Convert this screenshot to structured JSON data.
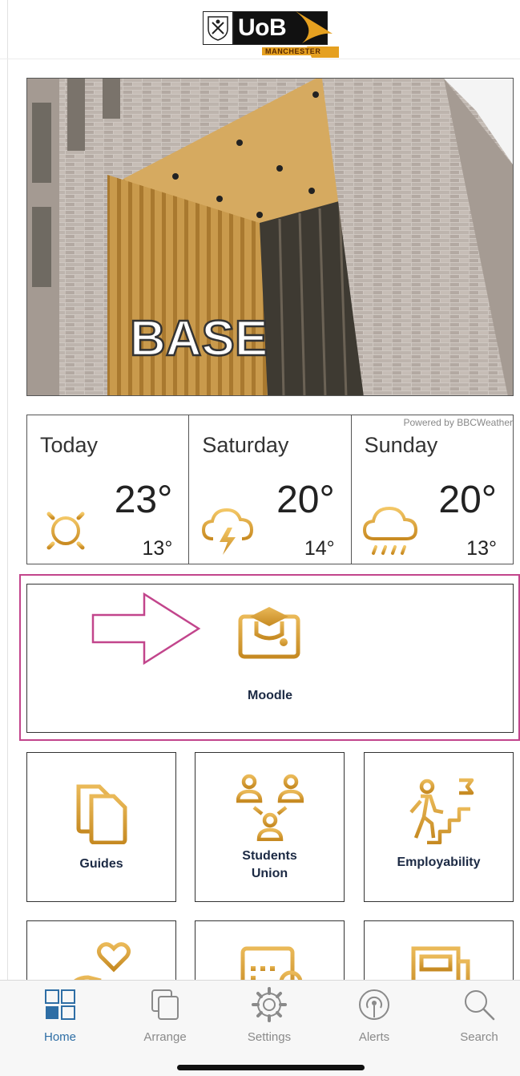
{
  "header": {
    "logo_text": "UoB",
    "logo_subtext": "MANCHESTER"
  },
  "hero": {
    "sign_text": "BASE"
  },
  "weather": {
    "powered_by": "Powered by BBCWeather",
    "days": [
      {
        "day": "Today",
        "high": "23°",
        "low": "13°",
        "icon": "sun-icon"
      },
      {
        "day": "Saturday",
        "high": "20°",
        "low": "14°",
        "icon": "thunderstorm-icon"
      },
      {
        "day": "Sunday",
        "high": "20°",
        "low": "13°",
        "icon": "rain-cloud-icon"
      }
    ]
  },
  "moodle": {
    "label": "Moodle",
    "icon": "graduation-monitor-icon",
    "highlight_color": "#c2458c"
  },
  "tiles": [
    {
      "label": "Guides",
      "icon": "documents-icon"
    },
    {
      "label": "Students\nUnion",
      "icon": "people-network-icon"
    },
    {
      "label": "Employability",
      "icon": "career-stairs-icon"
    },
    {
      "label": "",
      "icon": "heart-hand-icon"
    },
    {
      "label": "",
      "icon": "calendar-icon"
    },
    {
      "label": "",
      "icon": "newspaper-icon"
    }
  ],
  "tabbar": {
    "tabs": [
      {
        "label": "Home",
        "icon": "grid-icon",
        "active": true
      },
      {
        "label": "Arrange",
        "icon": "stack-icon",
        "active": false
      },
      {
        "label": "Settings",
        "icon": "gear-icon",
        "active": false
      },
      {
        "label": "Alerts",
        "icon": "broadcast-icon",
        "active": false
      },
      {
        "label": "Search",
        "icon": "magnifier-icon",
        "active": false
      }
    ]
  },
  "colors": {
    "accent_gold": "#d9a232",
    "active_blue": "#2e6ea5",
    "navy_text": "#1c2a44"
  }
}
